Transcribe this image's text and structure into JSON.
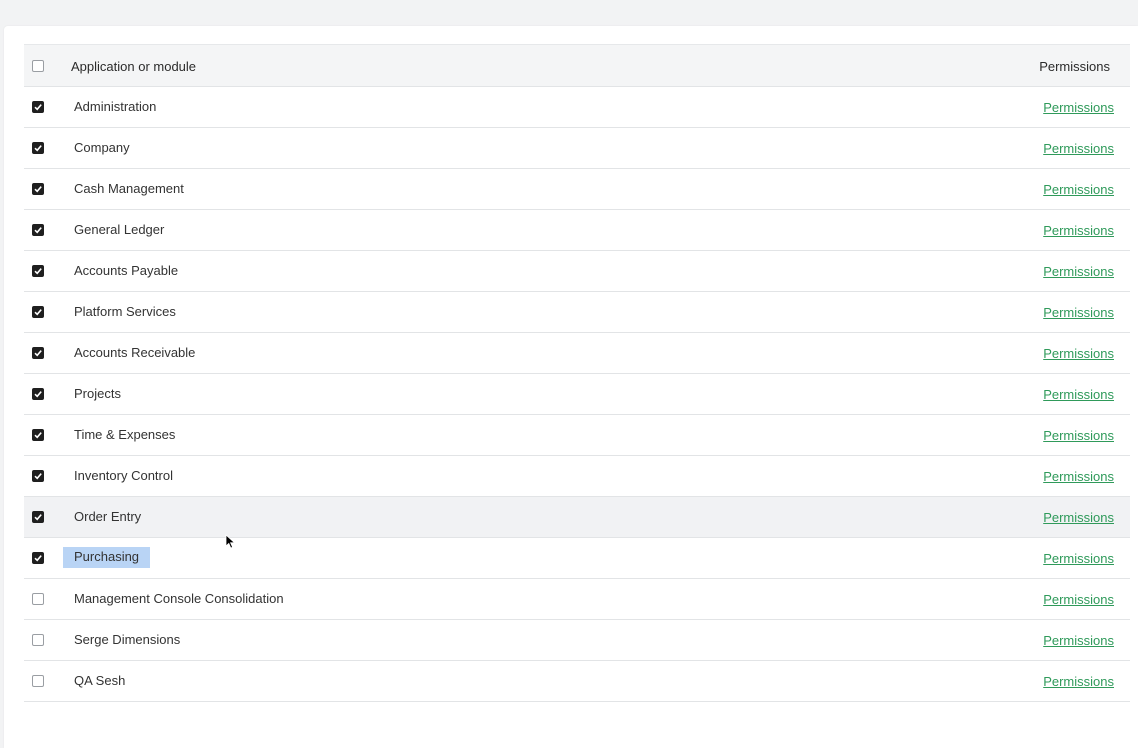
{
  "table": {
    "header": {
      "name": "Application or module",
      "permissions": "Permissions",
      "select_all_checked": false
    },
    "rows": [
      {
        "name": "Administration",
        "checked": true,
        "link": "Permissions"
      },
      {
        "name": "Company",
        "checked": true,
        "link": "Permissions"
      },
      {
        "name": "Cash Management",
        "checked": true,
        "link": "Permissions"
      },
      {
        "name": "General Ledger",
        "checked": true,
        "link": "Permissions"
      },
      {
        "name": "Accounts Payable",
        "checked": true,
        "link": "Permissions"
      },
      {
        "name": "Platform Services",
        "checked": true,
        "link": "Permissions"
      },
      {
        "name": "Accounts Receivable",
        "checked": true,
        "link": "Permissions"
      },
      {
        "name": "Projects",
        "checked": true,
        "link": "Permissions"
      },
      {
        "name": "Time & Expenses",
        "checked": true,
        "link": "Permissions"
      },
      {
        "name": "Inventory Control",
        "checked": true,
        "link": "Permissions"
      },
      {
        "name": "Order Entry",
        "checked": true,
        "link": "Permissions"
      },
      {
        "name": "Purchasing",
        "checked": true,
        "link": "Permissions"
      },
      {
        "name": "Management Console Consolidation",
        "checked": false,
        "link": "Permissions"
      },
      {
        "name": "Serge Dimensions",
        "checked": false,
        "link": "Permissions"
      },
      {
        "name": "QA Sesh",
        "checked": false,
        "link": "Permissions"
      }
    ]
  },
  "colors": {
    "link": "#2f9a5a",
    "selection": "#b9d4f5",
    "row_hover": "#f1f2f4"
  }
}
